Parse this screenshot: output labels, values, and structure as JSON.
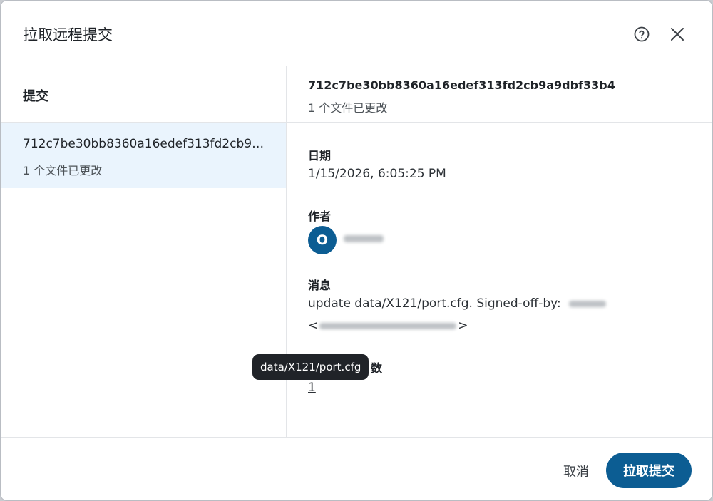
{
  "dialog": {
    "title": "拉取远程提交",
    "help_icon": "help-circle-icon",
    "close_icon": "close-icon"
  },
  "commits_panel": {
    "heading": "提交",
    "items": [
      {
        "hash": "712c7be30bb8360a16edef313fd2cb9a9dbf33b4",
        "files_changed": "1 个文件已更改"
      }
    ]
  },
  "detail": {
    "hash": "712c7be30bb8360a16edef313fd2cb9a9dbf33b4",
    "files_changed": "1 个文件已更改",
    "date_label": "日期",
    "date_value": "1/15/2026, 6:05:25 PM",
    "author_label": "作者",
    "author_initial": "O",
    "message_label": "消息",
    "message_line1": "update data/X121/port.cfg. Signed-off-by:",
    "message_line2_open": "<",
    "message_line2_close": ">",
    "files_label_suffix": "数",
    "file_count": "1"
  },
  "tooltip": {
    "text": "data/X121/port.cfg"
  },
  "footer": {
    "cancel_label": "取消",
    "primary_label": "拉取提交"
  },
  "colors": {
    "accent": "#0c5d93",
    "selected_row": "#eaf4fd",
    "tooltip_bg": "#202328"
  }
}
